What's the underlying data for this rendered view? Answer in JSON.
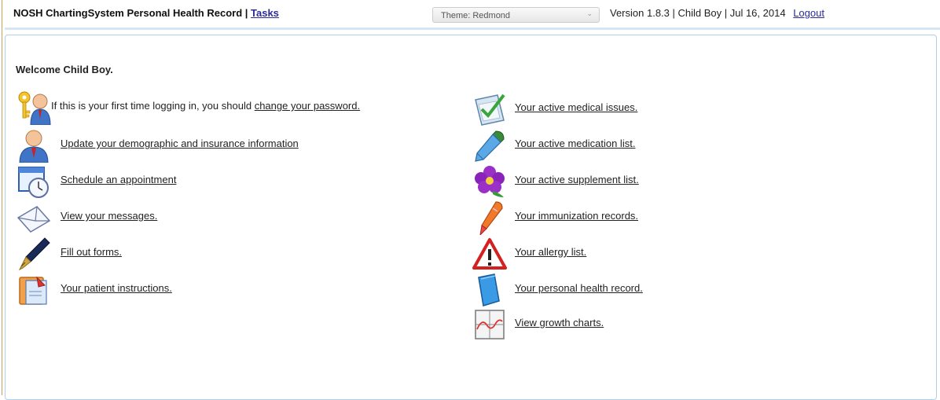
{
  "header": {
    "title": "NOSH ChartingSystem Personal Health Record |",
    "tasks_link": "Tasks",
    "theme_label": "Theme: Redmond",
    "theme_arrow": "⌄",
    "version_info": "Version 1.8.3  |  Child Boy  |  Jul 16, 2014",
    "logout": "Logout"
  },
  "welcome": "Welcome Child Boy.",
  "left_items": [
    {
      "prefix": "If this is your first time logging in, you should ",
      "link": "change your password.",
      "icon": "keys-user-icon"
    },
    {
      "link": "Update your demographic and insurance information",
      "icon": "user-info-icon"
    },
    {
      "link": "Schedule an appointment",
      "icon": "calendar-clock-icon"
    },
    {
      "link": "View your messages.",
      "icon": "envelope-icon"
    },
    {
      "link": "Fill out forms.",
      "icon": "fountain-pen-icon"
    },
    {
      "link": "Your patient instructions.",
      "icon": "instructions-icon"
    }
  ],
  "right_items": [
    {
      "link": "Your active medical issues.",
      "icon": "clipboard-check-icon"
    },
    {
      "link": "Your active medication list.",
      "icon": "dropper-icon"
    },
    {
      "link": "Your active supplement list.",
      "icon": "flower-icon"
    },
    {
      "link": "Your immunization records.",
      "icon": "marker-icon"
    },
    {
      "link": "Your allergy list.",
      "icon": "warning-icon"
    },
    {
      "link": "Your personal health record.",
      "icon": "book-icon"
    },
    {
      "link": "View growth charts.",
      "icon": "growth-chart-icon"
    }
  ]
}
